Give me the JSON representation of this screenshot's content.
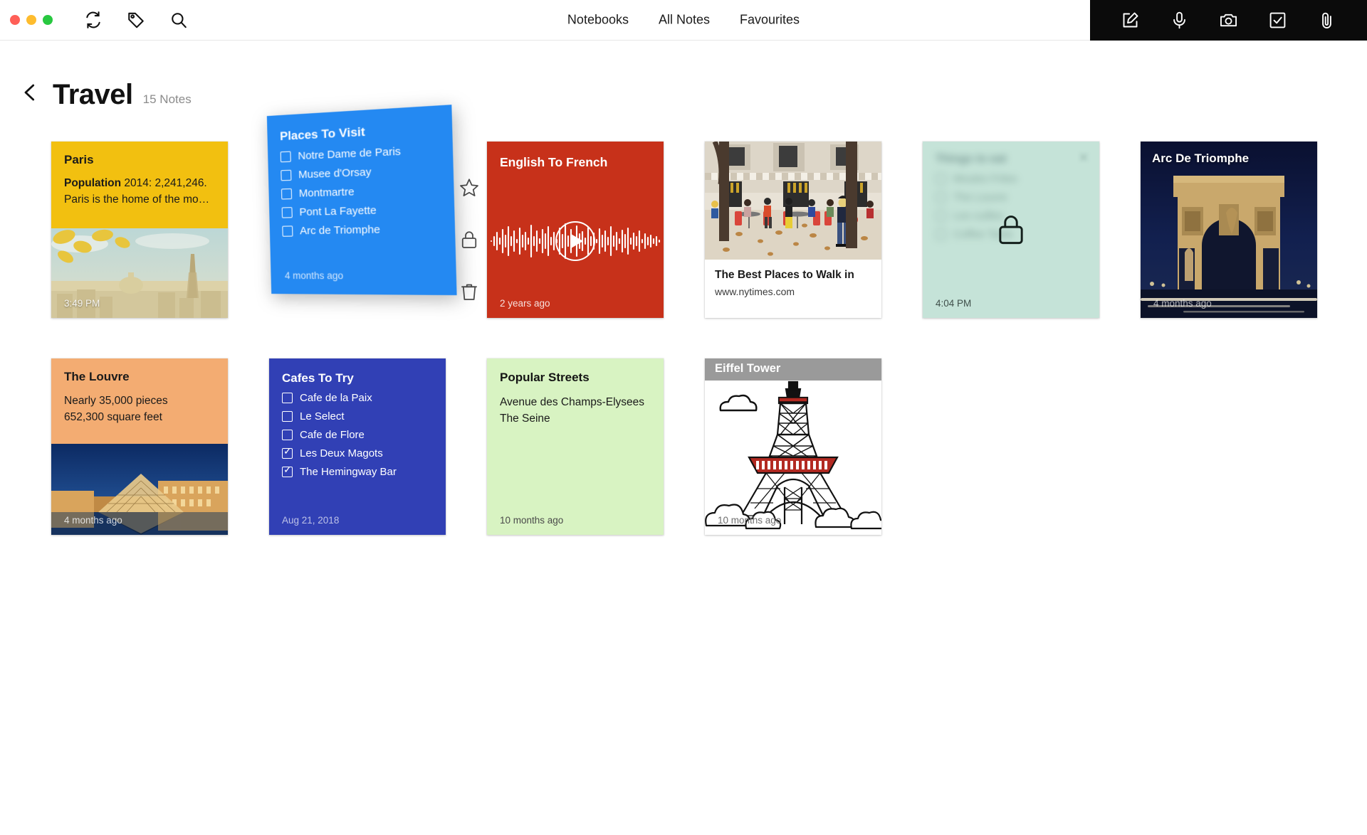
{
  "window": {
    "traffic_lights": [
      "close",
      "minimize",
      "zoom"
    ],
    "toolbar_icons": [
      "sync-icon",
      "tag-icon",
      "search-icon"
    ],
    "nav": [
      {
        "label": "Notebooks"
      },
      {
        "label": "All Notes"
      },
      {
        "label": "Favourites"
      }
    ],
    "action_icons": [
      "compose-icon",
      "microphone-icon",
      "camera-icon",
      "checklist-icon",
      "attachment-icon"
    ],
    "action_bar_bg": "#0b0b0b"
  },
  "header": {
    "back": "‹",
    "title": "Travel",
    "count": "15 Notes"
  },
  "drag_actions": [
    "star-icon",
    "lock-icon",
    "trash-icon"
  ],
  "notes": {
    "paris": {
      "title": "Paris",
      "line1_bold": "Population",
      "line1_rest": " 2014: 2,241,246.",
      "line2": "Paris is the home of the mo…",
      "time": "3:49 PM",
      "color": "#f2c010"
    },
    "places": {
      "title": "Places To Visit",
      "items": [
        {
          "label": "Notre Dame de Paris",
          "checked": false
        },
        {
          "label": "Musee d'Orsay",
          "checked": false
        },
        {
          "label": "Montmartre",
          "checked": false
        },
        {
          "label": "Pont La Fayette",
          "checked": false
        },
        {
          "label": "Arc de Triomphe",
          "checked": false
        }
      ],
      "time": "4 months ago",
      "color": "#2489f2"
    },
    "audio": {
      "title": "English To French",
      "time": "2 years ago",
      "color": "#c7311a",
      "play": "play-button"
    },
    "web": {
      "title": "The Best Places to Walk in",
      "url": "www.nytimes.com"
    },
    "locked": {
      "blurred_title": "Things to eat",
      "blurred_items": [
        "Moules Frites",
        "The Louvre",
        "Les cuilles",
        "Coffee Taste"
      ],
      "time": "4:04 PM",
      "color": "#c5e3d8"
    },
    "arc": {
      "title": "Arc De Triomphe",
      "time": "4 months ago"
    },
    "louvre": {
      "title": "The Louvre",
      "line1": "Nearly 35,000 pieces",
      "line2": "652,300 square feet",
      "time": "4 months ago",
      "color": "#f3ac72"
    },
    "cafes": {
      "title": "Cafes To Try",
      "items": [
        {
          "label": "Cafe de la Paix",
          "checked": false
        },
        {
          "label": "Le Select",
          "checked": false
        },
        {
          "label": "Cafe de Flore",
          "checked": false
        },
        {
          "label": "Les Deux Magots",
          "checked": true
        },
        {
          "label": "The Hemingway Bar",
          "checked": true
        }
      ],
      "time": "Aug 21, 2018",
      "color": "#3140b5"
    },
    "streets": {
      "title": "Popular Streets",
      "line1": "Avenue des Champs-Elysees",
      "line2": "The Seine",
      "time": "10 months ago",
      "color": "#d8f3c2"
    },
    "sketch": {
      "title": "Eiffel Tower",
      "time": "10 months ago"
    }
  }
}
